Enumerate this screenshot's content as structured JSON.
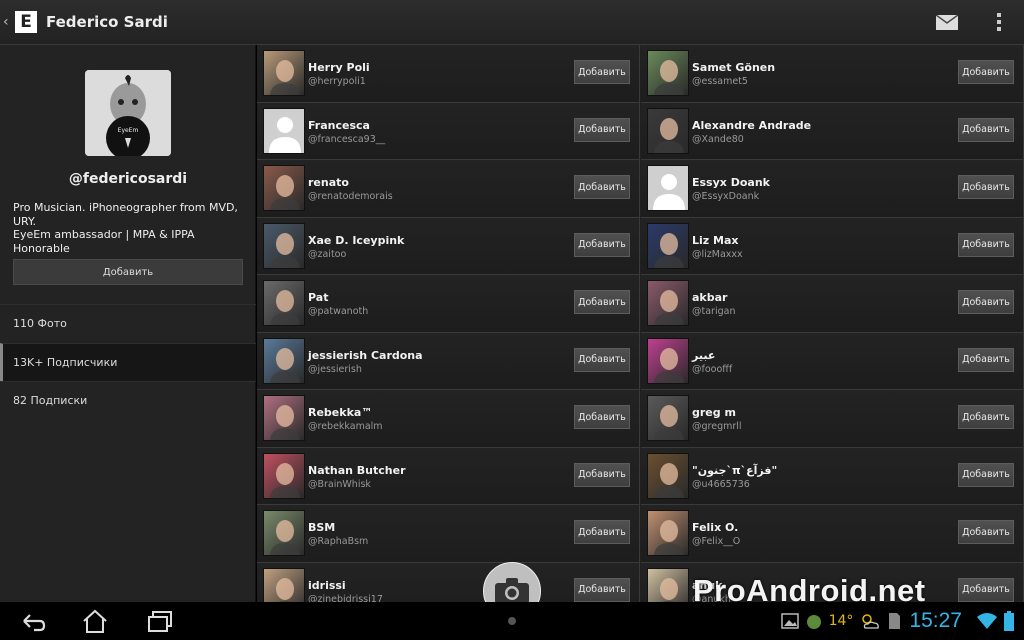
{
  "actionbar": {
    "title": "Federico Sardi",
    "logo_letter": "E"
  },
  "profile": {
    "username": "@federicosardi",
    "bio_line1": "Pro Musician. iPhoneographer from MVD,",
    "bio_line2": "URY.",
    "bio_line3": "EyeEm ambassador | MPA & IPPA Honorable",
    "add_label": "Добавить",
    "stats": [
      {
        "label": "110 Фото"
      },
      {
        "label": "13K+ Подписчики"
      },
      {
        "label": "82 Подписки"
      }
    ]
  },
  "users_left": [
    {
      "name": "Herry Poli",
      "handle": "@herrypoli1",
      "color": "#b89a78"
    },
    {
      "name": "Francesca",
      "handle": "@francesca93__",
      "color": "#cfcfcf"
    },
    {
      "name": "renato",
      "handle": "@renatodemorais",
      "color": "#8a5a4a"
    },
    {
      "name": "Xae D. Iceypink",
      "handle": "@zaitoo",
      "color": "#4a5a6a"
    },
    {
      "name": "Pat",
      "handle": "@patwanoth",
      "color": "#6a6a6a"
    },
    {
      "name": "jessierish Cardona",
      "handle": "@jessierish",
      "color": "#5a7a9a"
    },
    {
      "name": "Rebekka™",
      "handle": "@rebekkamalm",
      "color": "#b07080"
    },
    {
      "name": "Nathan Butcher",
      "handle": "@BrainWhisk",
      "color": "#c05060"
    },
    {
      "name": "BSM",
      "handle": "@RaphaBsm",
      "color": "#7a8a6a"
    },
    {
      "name": "idrissi",
      "handle": "@zinebidrissi17",
      "color": "#c0a080"
    }
  ],
  "users_right": [
    {
      "name": "Samet Gönen",
      "handle": "@essamet5",
      "color": "#6a8a5a"
    },
    {
      "name": "Alexandre Andrade",
      "handle": "@Xande80",
      "color": "#3a3a3a"
    },
    {
      "name": "Essyx Doank",
      "handle": "@EssyxDoank",
      "color": "#cfcfcf"
    },
    {
      "name": "Liz Max",
      "handle": "@lizMaxxx",
      "color": "#2a3a6a"
    },
    {
      "name": "akbar",
      "handle": "@tarigan",
      "color": "#8a5a6a"
    },
    {
      "name": "عبير",
      "handle": "@fooofff",
      "color": "#c04090"
    },
    {
      "name": "greg m",
      "handle": "@gregmrll",
      "color": "#5a5a5a"
    },
    {
      "name": "\"جنون`π`فزآع\"",
      "handle": "@u4665736",
      "color": "#6a5030"
    },
    {
      "name": "Felix O.",
      "handle": "@Felix__O",
      "color": "#c09070"
    },
    {
      "name": "anuk",
      "handle": "@anukh",
      "color": "#d0c0a0"
    }
  ],
  "add_label": "Добавить",
  "status": {
    "temperature": "14°",
    "time": "15:27"
  },
  "watermark": "ProAndroid.net"
}
